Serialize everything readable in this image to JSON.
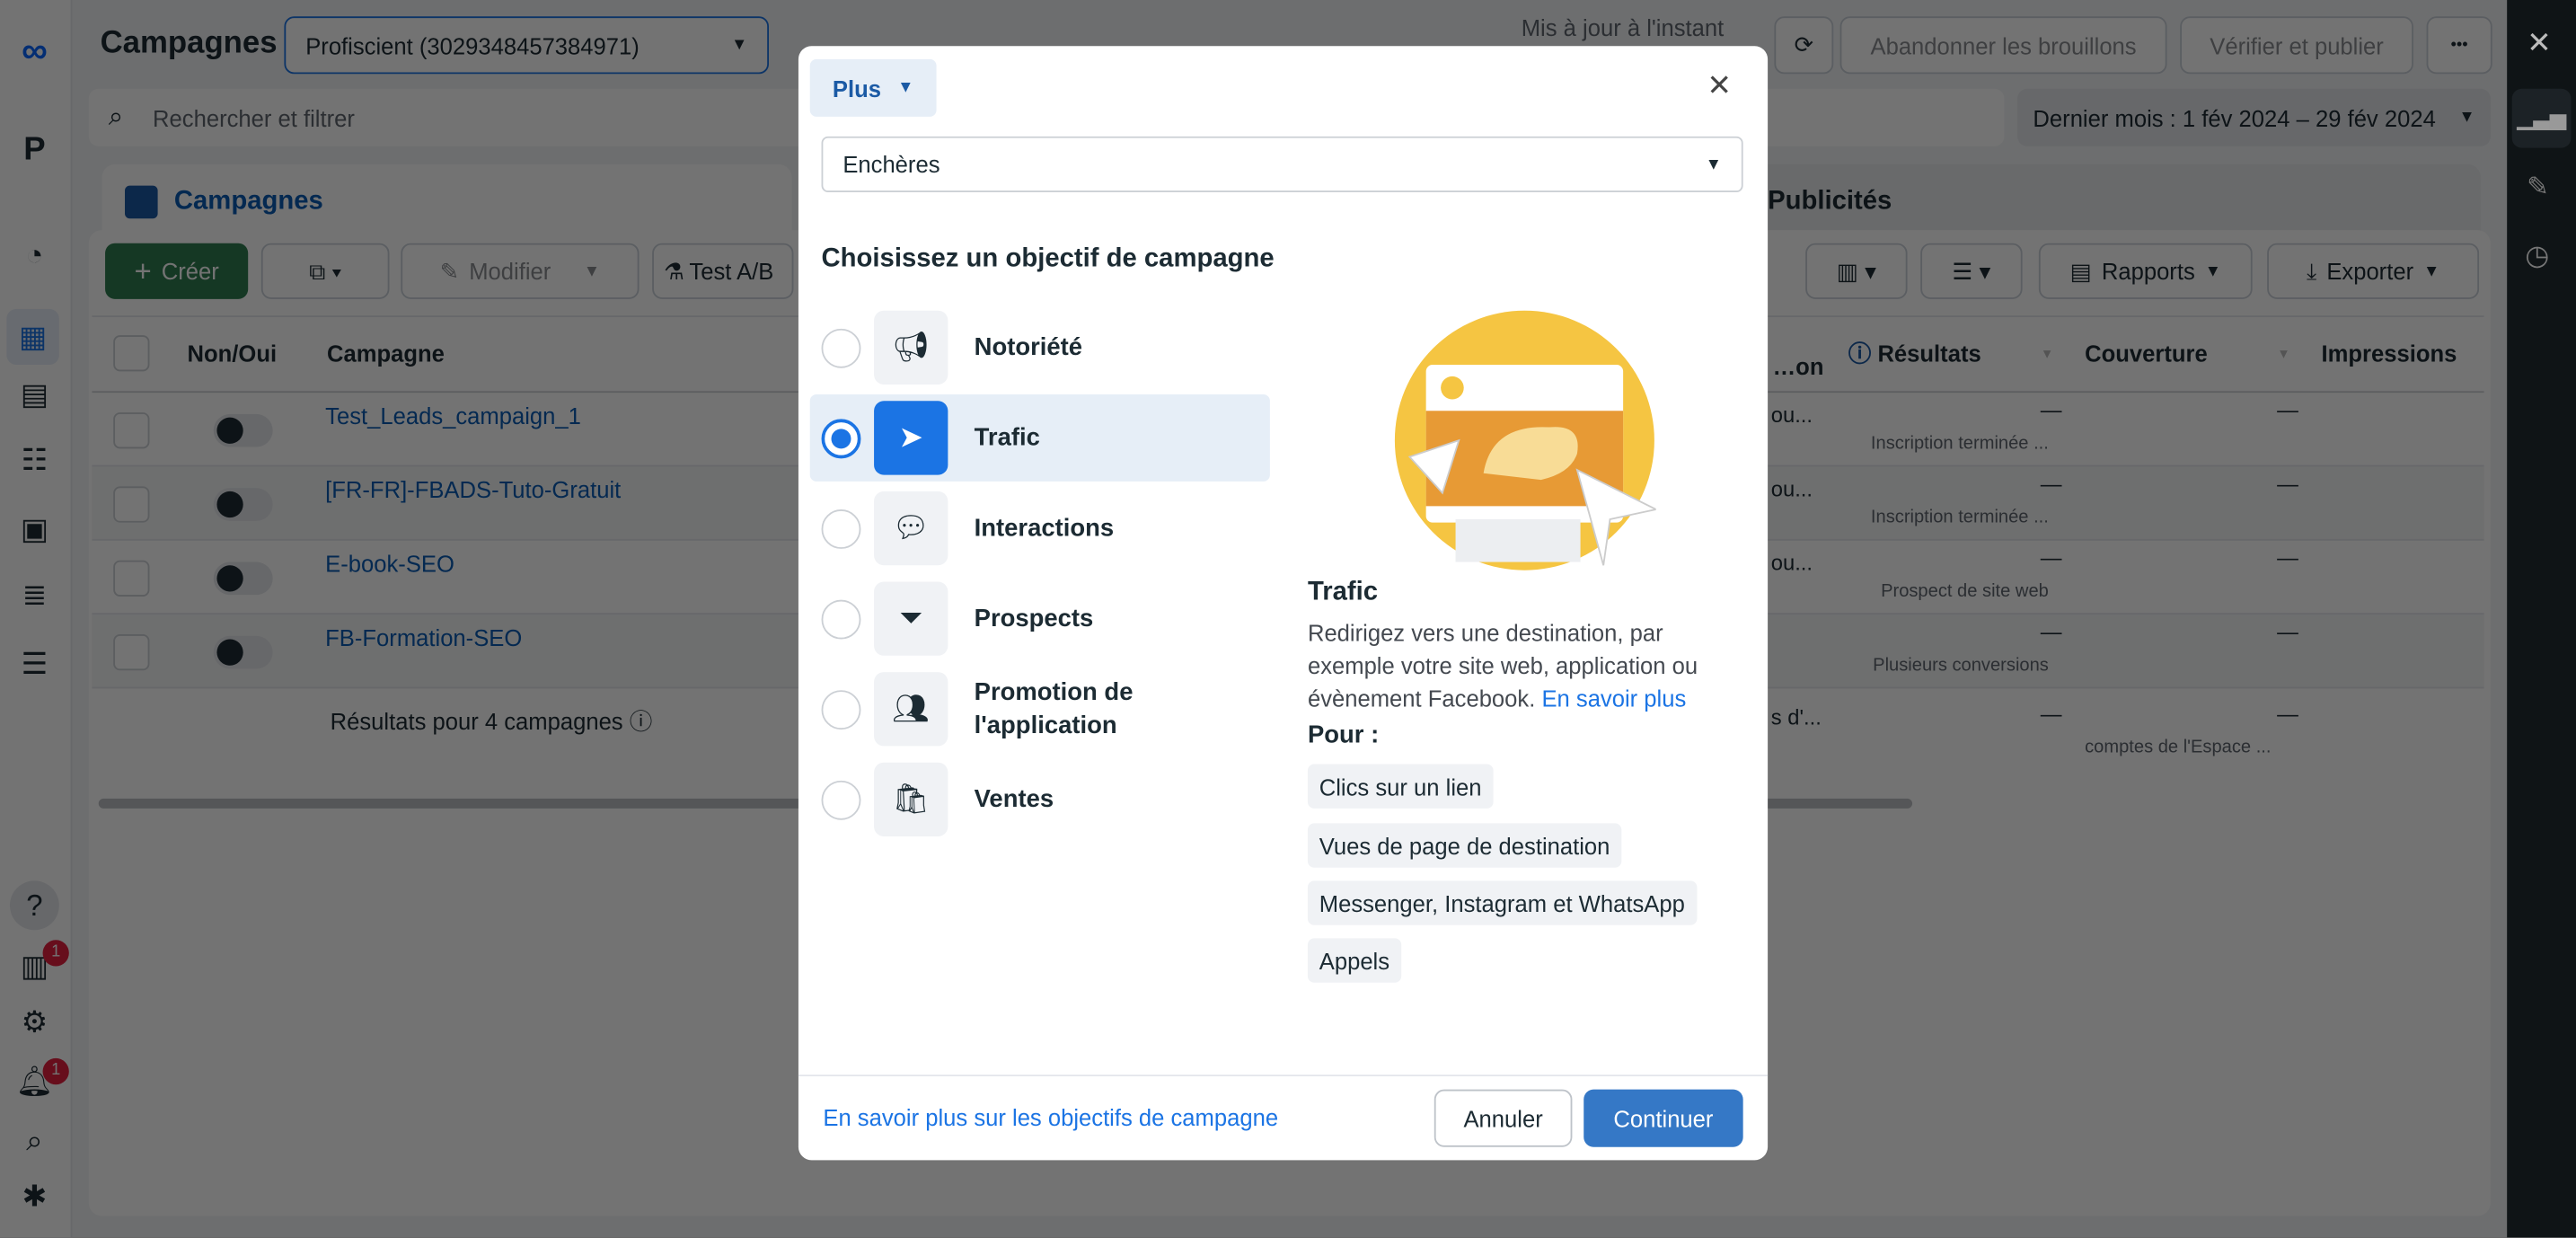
{
  "header": {
    "title": "Campagnes",
    "account": "Profiscient (3029348457384971)",
    "status": "Mis à jour à l'instant",
    "discard": "Abandonner les brouillons",
    "publish": "Vérifier et publier",
    "more": "•••"
  },
  "search": {
    "placeholder": "Rechercher et filtrer",
    "date_range": "Dernier mois : 1 fév 2024 – 29 fév 2024"
  },
  "tabs": {
    "campaigns": "Campagnes",
    "ads": "Publicités"
  },
  "toolbar": {
    "create": "Créer",
    "edit": "Modifier",
    "ab_test": "Test A/B",
    "reports": "Rapports",
    "export": "Exporter"
  },
  "table": {
    "headers": [
      "Non/Oui",
      "Campagne",
      "…on",
      "Résultats",
      "Couverture",
      "Impressions"
    ],
    "rows": [
      {
        "name": "Test_Leads_campaign_1",
        "col": "ou...",
        "results": "—",
        "results_sub": "Inscription terminée ...",
        "reach": "—"
      },
      {
        "name": "[FR-FR]-FBADS-Tuto-Gratuit",
        "col": "ou...",
        "results": "—",
        "results_sub": "Inscription terminée ...",
        "reach": "—"
      },
      {
        "name": "E-book-SEO",
        "col": "ou...",
        "results": "—",
        "results_sub": "Prospect de site web",
        "reach": "—"
      },
      {
        "name": "FB-Formation-SEO",
        "col": "",
        "results": "—",
        "results_sub": "Plusieurs conversions",
        "reach": "—"
      }
    ],
    "summary": {
      "label": "Résultats pour 4 campagnes",
      "col": "s d'...",
      "results": "—",
      "reach": "—",
      "reach_sub": "comptes de l'Espace ..."
    }
  },
  "sidebar": {
    "badges": {
      "notifications": "1",
      "alerts": "1"
    }
  },
  "modal": {
    "mode": "Plus",
    "buying_type": "Enchères",
    "heading": "Choisissez un objectif de campagne",
    "objectives": [
      {
        "label": "Notoriété",
        "icon": "megaphone-icon",
        "selected": false
      },
      {
        "label": "Trafic",
        "icon": "cursor-icon",
        "selected": true
      },
      {
        "label": "Interactions",
        "icon": "chat-bubbles-icon",
        "selected": false
      },
      {
        "label": "Prospects",
        "icon": "funnel-icon",
        "selected": false
      },
      {
        "label": "Promotion de l'application",
        "icon": "people-icon",
        "selected": false
      },
      {
        "label": "Ventes",
        "icon": "shopping-bag-icon",
        "selected": false
      }
    ],
    "detail": {
      "title": "Trafic",
      "description": "Redirigez vers une destination, par exemple votre site web, application ou évènement Facebook.",
      "learn_more": "En savoir plus",
      "for_label": "Pour :",
      "uses": [
        "Clics sur un lien",
        "Vues de page de destination",
        "Messenger, Instagram et WhatsApp",
        "Appels"
      ]
    },
    "footer": {
      "link": "En savoir plus sur les objectifs de campagne",
      "cancel": "Annuler",
      "continue": "Continuer"
    }
  },
  "colors": {
    "primary": "#1b74e4",
    "create_green": "#2e7d4f",
    "illustration_yellow": "#f5c542"
  }
}
